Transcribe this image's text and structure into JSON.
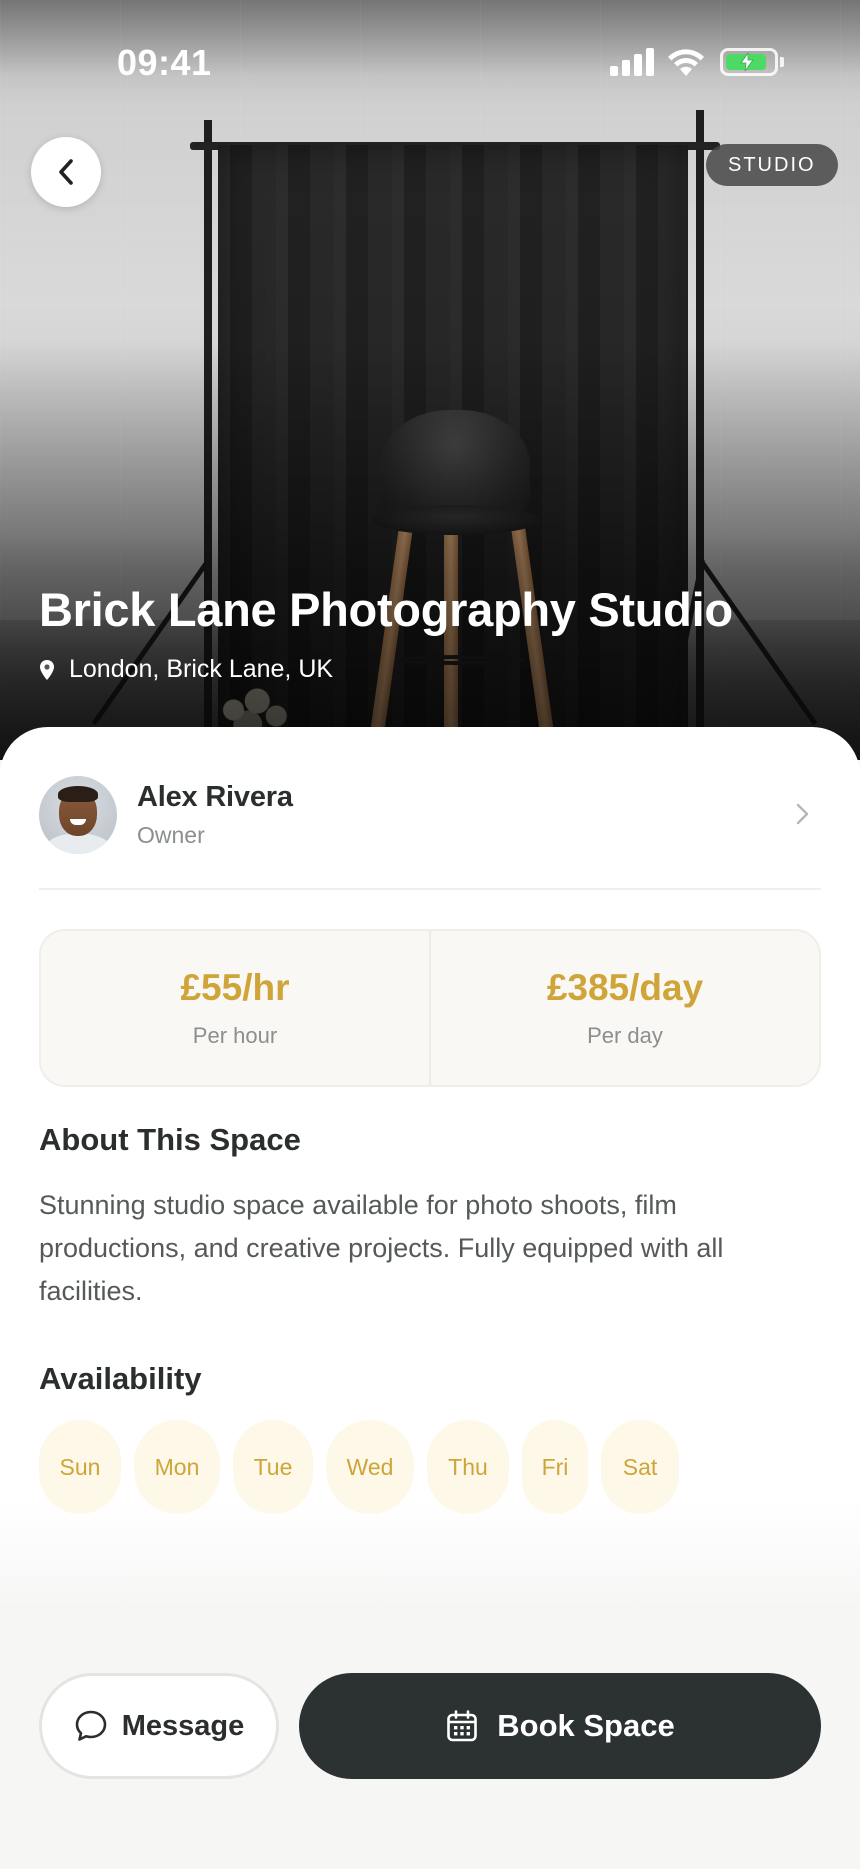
{
  "status_bar": {
    "time": "09:41"
  },
  "hero": {
    "tag": "STUDIO",
    "title": "Brick Lane Photography Studio",
    "location": "London, Brick Lane, UK"
  },
  "owner": {
    "name": "Alex Rivera",
    "role": "Owner"
  },
  "pricing": [
    {
      "value": "£55/hr",
      "label": "Per hour"
    },
    {
      "value": "£385/day",
      "label": "Per day"
    }
  ],
  "about": {
    "title": "About This Space",
    "body": "Stunning studio space available for photo shoots, film productions, and creative projects. Fully equipped with all facilities."
  },
  "availability": {
    "title": "Availability",
    "days": [
      "Sun",
      "Mon",
      "Tue",
      "Wed",
      "Thu",
      "Fri",
      "Sat"
    ]
  },
  "actions": {
    "message_label": "Message",
    "book_label": "Book Space"
  },
  "colors": {
    "accent": "#cfa53a",
    "dark": "#2b3231",
    "day_bg": "#fdf8e8"
  },
  "icons": {
    "back": "chevron-left-icon",
    "location": "location-pin-icon",
    "owner_chevron": "chevron-right-icon",
    "message": "chat-bubble-icon",
    "book": "calendar-icon"
  }
}
